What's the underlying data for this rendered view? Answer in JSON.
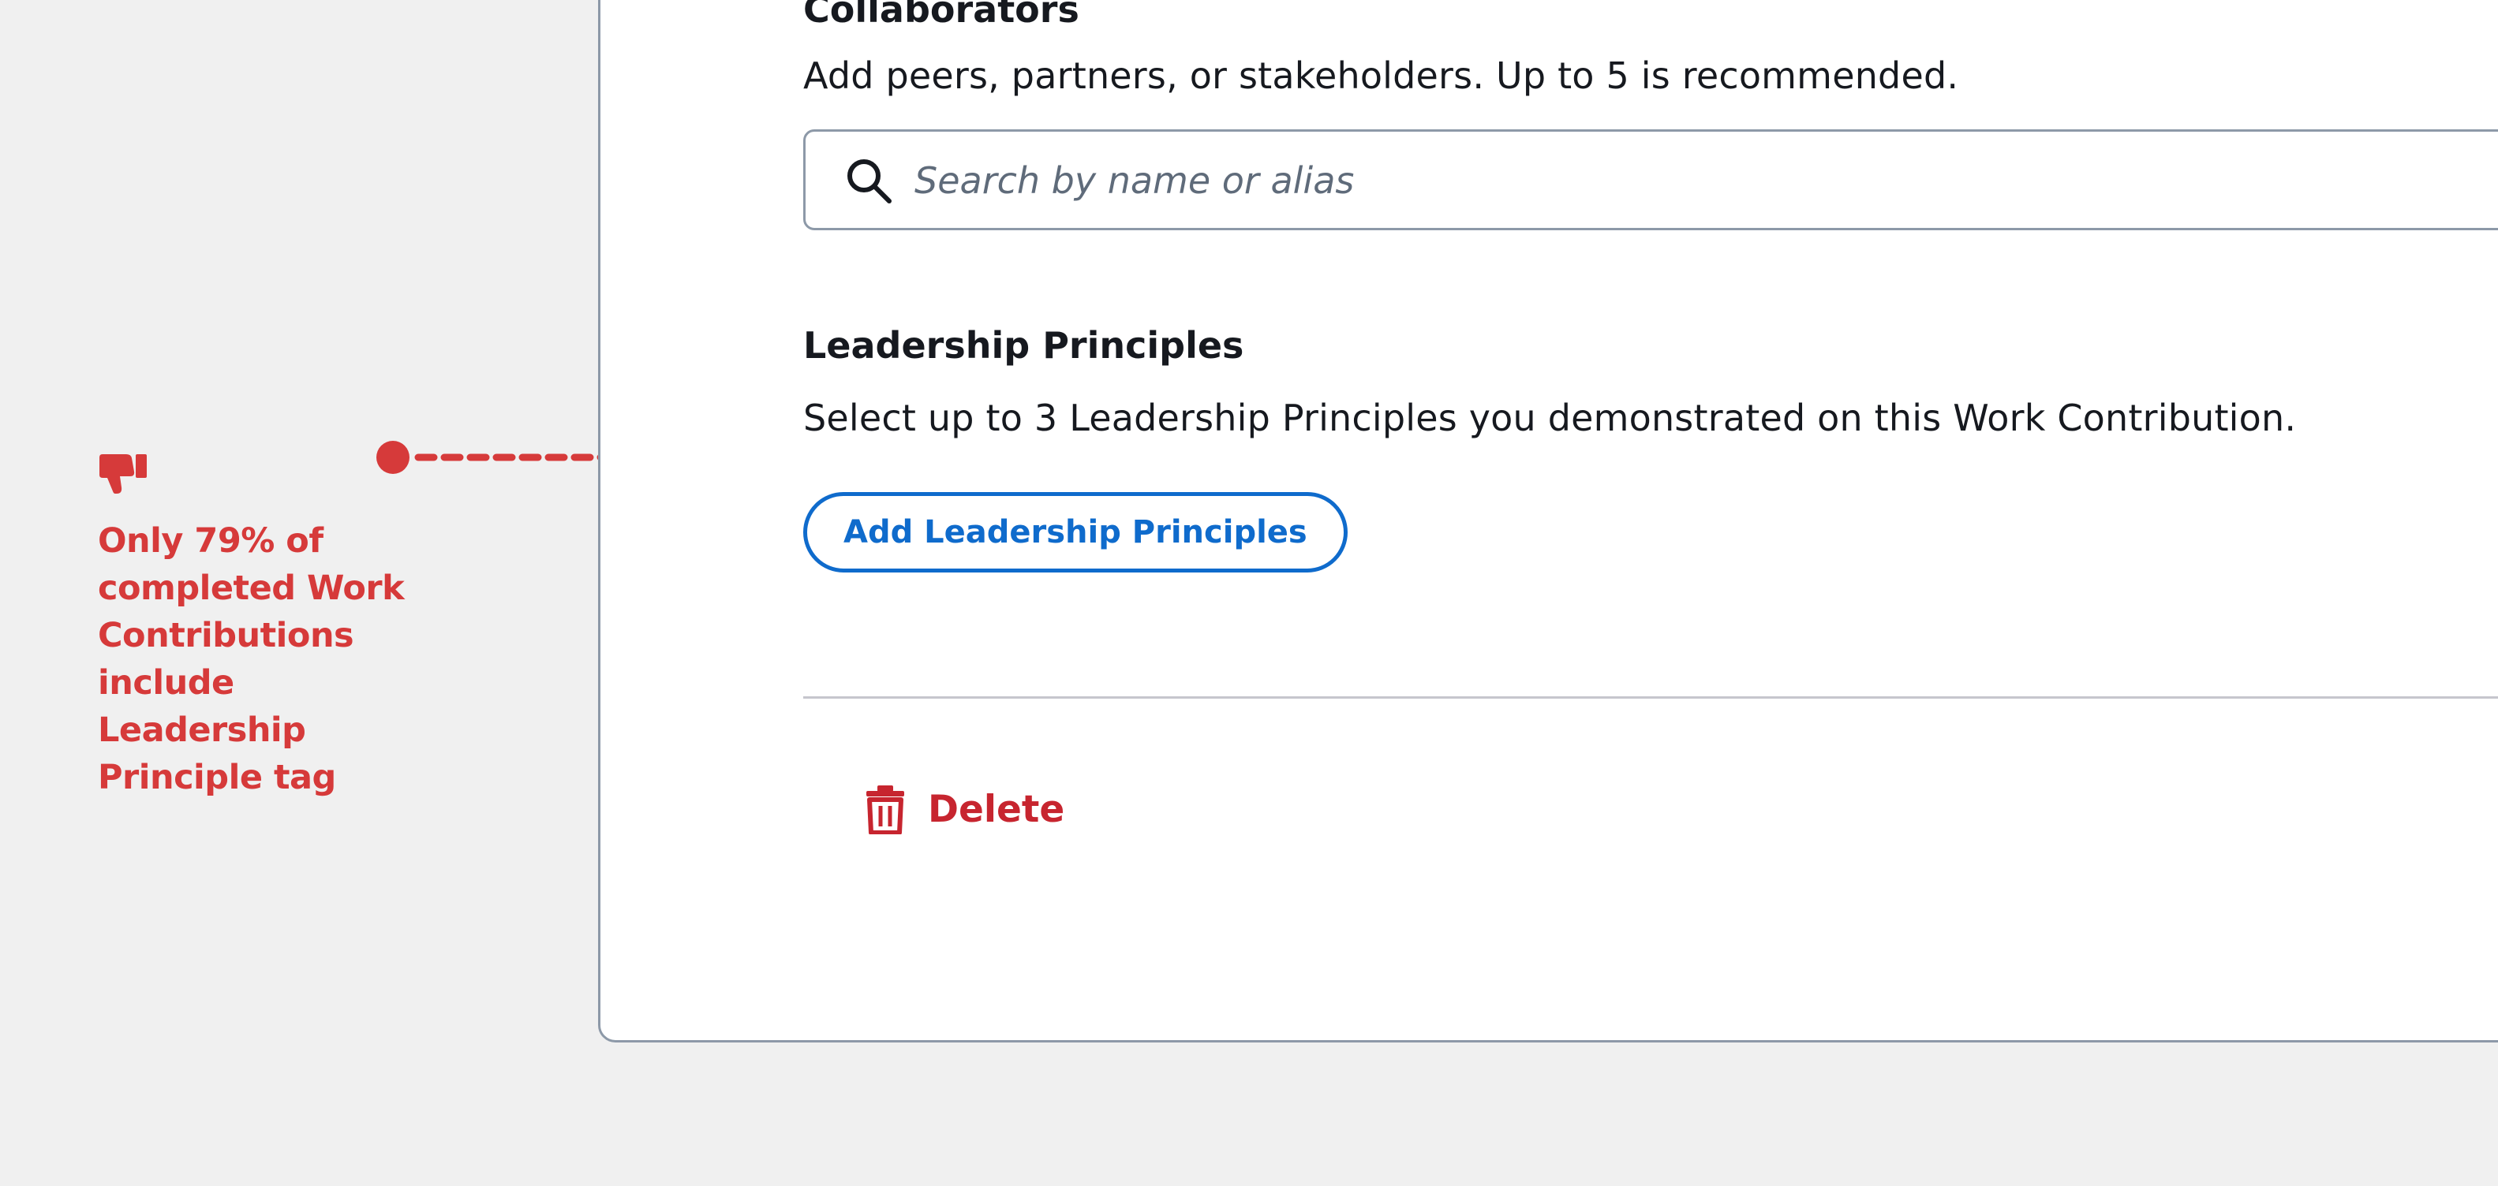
{
  "annotation": {
    "icon": "thumbs-down-icon",
    "text": "Only 79% of completed Work Contributions include Leadership Principle tag",
    "color": "#d63a3a"
  },
  "collaborators": {
    "title": "Collaborators",
    "description": "Add peers, partners, or stakeholders. Up to 5 is recommended.",
    "search_placeholder": "Search by name or alias",
    "search_value": ""
  },
  "leadership_principles": {
    "title": "Leadership Principles",
    "description": "Select up to 3 Leadership Principles you demonstrated on this Work Contribution.",
    "add_button_label": "Add Leadership Principles"
  },
  "footer": {
    "delete_label": "Delete"
  },
  "colors": {
    "page_background": "#f0f0f0",
    "card_background": "#ffffff",
    "border": "#8d99a8",
    "text": "#16191f",
    "link_blue": "#0f6bcc",
    "danger_red": "#c7252f",
    "annotation_red": "#d63a3a"
  }
}
